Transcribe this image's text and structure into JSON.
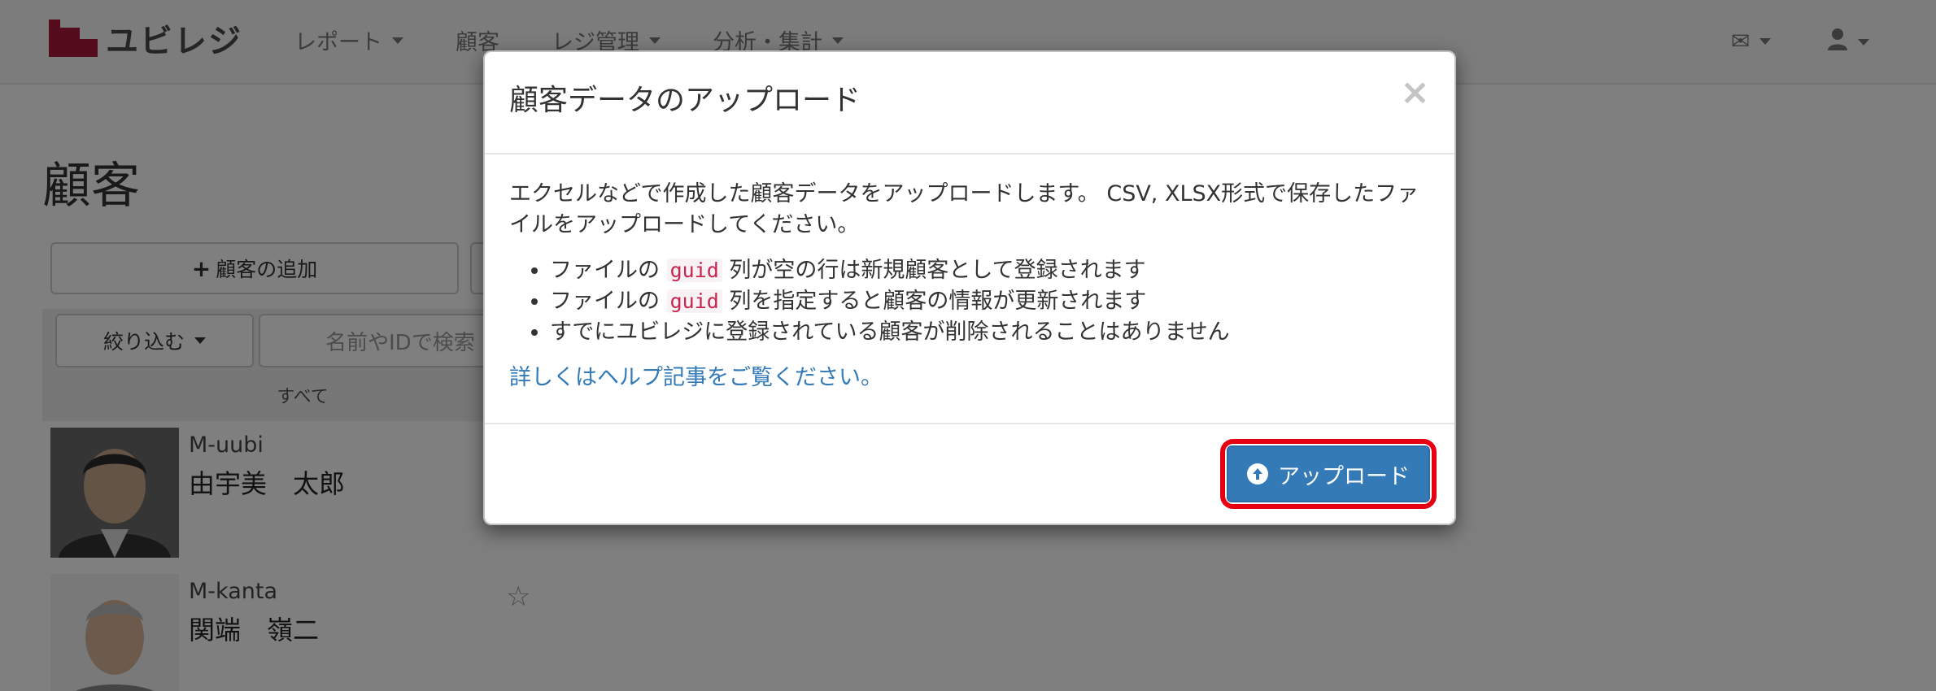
{
  "app": {
    "logo_text": "ユビレジ",
    "nav": [
      {
        "label": "レポート"
      },
      {
        "label": "顧客"
      },
      {
        "label": "レジ管理"
      },
      {
        "label": "分析・集計"
      }
    ]
  },
  "page": {
    "title": "顧客",
    "add_button": "顧客の追加",
    "filter_button": "絞り込む",
    "search_placeholder": "名前やIDで検索",
    "filter_all": "すべて",
    "customers": [
      {
        "code": "M-uubi",
        "name": "由宇美　太郎"
      },
      {
        "code": "M-kanta",
        "name": "関端　嶺二"
      }
    ]
  },
  "modal": {
    "title": "顧客データのアップロード",
    "close": "×",
    "description": "エクセルなどで作成した顧客データをアップロードします。 CSV, XLSX形式で保存したファイルをアップロードしてください。",
    "bullets": [
      {
        "pre": "ファイルの ",
        "code": "guid",
        "post": " 列が空の行は新規顧客として登録されます"
      },
      {
        "pre": "ファイルの ",
        "code": "guid",
        "post": " 列を指定すると顧客の情報が更新されます"
      },
      {
        "text": "すでにユビレジに登録されている顧客が削除されることはありません"
      }
    ],
    "help_link": "詳しくはヘルプ記事をご覧ください。",
    "upload_button": "アップロード"
  },
  "colors": {
    "primary": "#337ab7",
    "highlight": "#e60012",
    "brand": "#a8193a"
  }
}
